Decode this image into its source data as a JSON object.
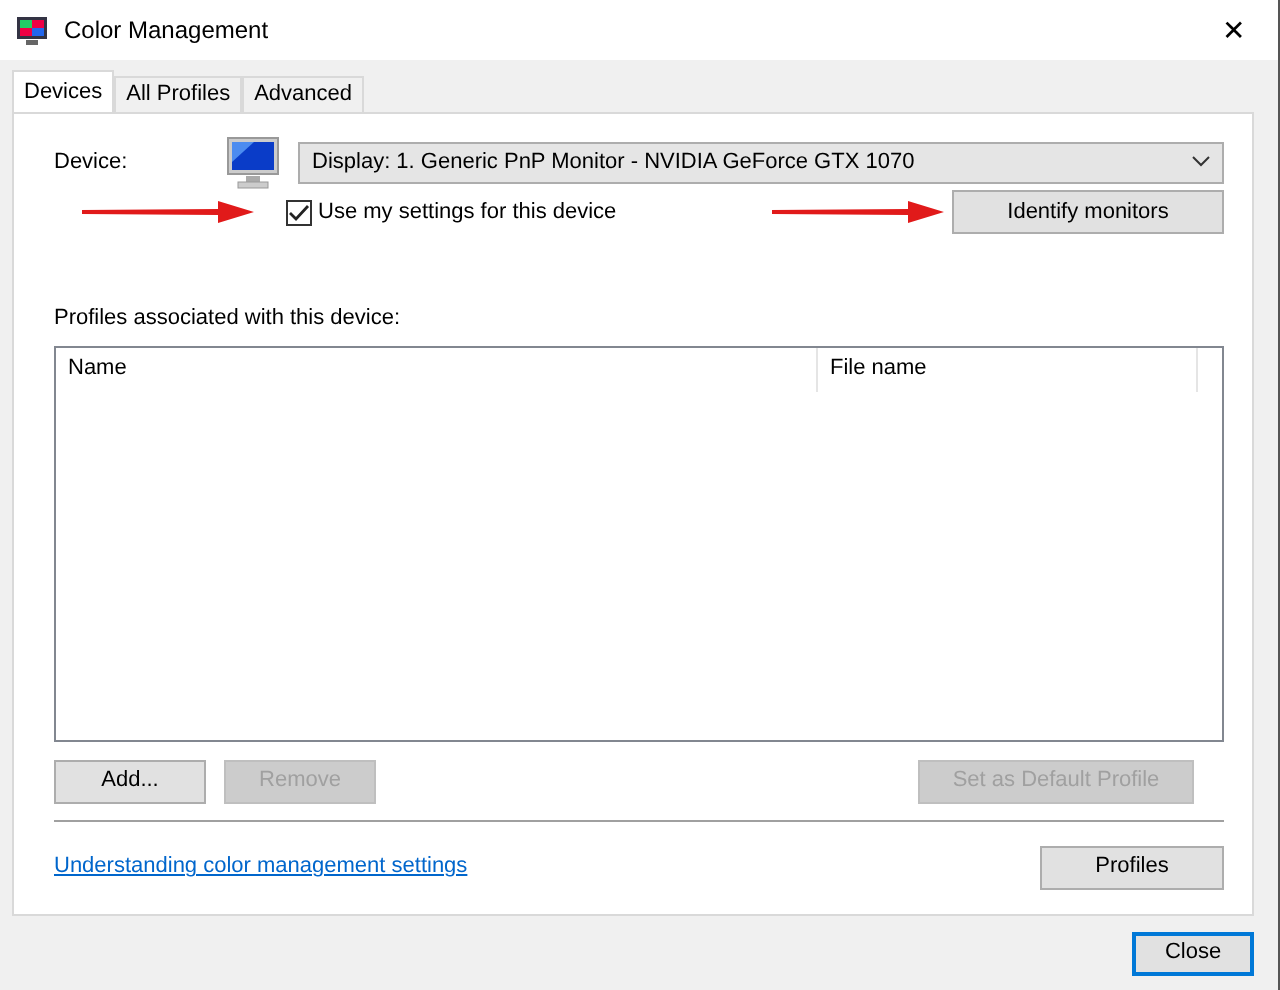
{
  "window": {
    "title": "Color Management",
    "close": "✕"
  },
  "tabs": [
    {
      "label": "Devices",
      "selected": true
    },
    {
      "label": "All Profiles",
      "selected": false
    },
    {
      "label": "Advanced",
      "selected": false
    }
  ],
  "device": {
    "label": "Device:",
    "value": "Display: 1. Generic PnP Monitor - NVIDIA GeForce GTX 1070"
  },
  "use_settings": {
    "label": "Use my settings for this device",
    "checked": true
  },
  "identify_button": {
    "label": "Identify monitors",
    "disabled": false
  },
  "profiles_label": "Profiles associated with this device:",
  "table": {
    "columns": [
      "Name",
      "File name"
    ]
  },
  "list_buttons": [
    {
      "label": "Add...",
      "disabled": false
    },
    {
      "label": "Remove",
      "disabled": true
    },
    {
      "label": "Set as Default Profile",
      "disabled": true
    }
  ],
  "link": "Understanding color management settings",
  "profiles_button": {
    "label": "Profiles",
    "disabled": false
  },
  "close_button": {
    "label": "Close",
    "default": true
  }
}
